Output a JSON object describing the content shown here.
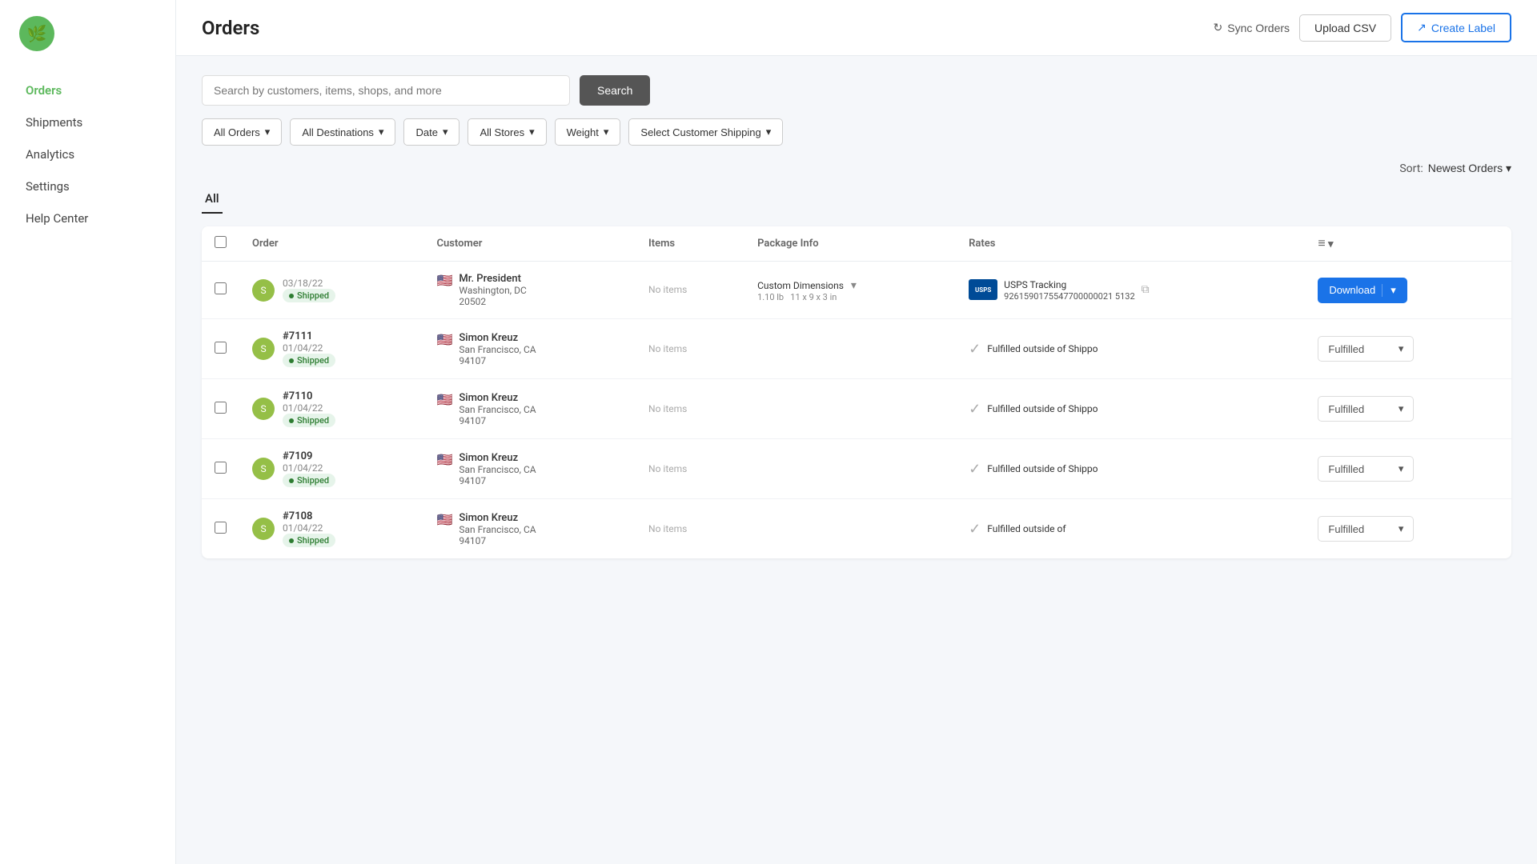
{
  "sidebar": {
    "logo_emoji": "🌿",
    "items": [
      {
        "id": "orders",
        "label": "Orders",
        "active": true
      },
      {
        "id": "shipments",
        "label": "Shipments",
        "active": false
      },
      {
        "id": "analytics",
        "label": "Analytics",
        "active": false
      },
      {
        "id": "settings",
        "label": "Settings",
        "active": false
      },
      {
        "id": "help-center",
        "label": "Help Center",
        "active": false
      }
    ]
  },
  "header": {
    "title": "Orders",
    "sync_label": "Sync Orders",
    "upload_label": "Upload CSV",
    "create_label": "Create Label"
  },
  "search": {
    "placeholder": "Search by customers, items, shops, and more",
    "button_label": "Search"
  },
  "filters": {
    "all_orders": "All Orders",
    "all_destinations": "All Destinations",
    "date": "Date",
    "all_stores": "All Stores",
    "weight": "Weight",
    "select_customer_shipping": "Select Customer Shipping"
  },
  "sort": {
    "label": "Sort:",
    "value": "Newest Orders"
  },
  "tab": {
    "label": "All"
  },
  "table": {
    "headers": [
      "",
      "Order",
      "Customer",
      "Items",
      "Package Info",
      "Rates",
      ""
    ],
    "rows": [
      {
        "id": "row-1",
        "order_num": "",
        "order_date": "03/18/22",
        "store_type": "shopify",
        "status": "Shipped",
        "customer_name": "Mr. President",
        "customer_city": "Washington, DC",
        "customer_zip": "20502",
        "items": "No items",
        "pkg_info": "Custom Dimensions",
        "pkg_weight": "1.10 lb",
        "pkg_dims": "11 x 9 x 3 in",
        "rates_type": "usps",
        "tracking_label": "USPS Tracking",
        "tracking_num": "9261590175547700000021 5132",
        "action": "download"
      },
      {
        "id": "row-2",
        "order_num": "#7111",
        "order_date": "01/04/22",
        "store_type": "shopify",
        "status": "Shipped",
        "customer_name": "Simon Kreuz",
        "customer_city": "San Francisco, CA",
        "customer_zip": "94107",
        "items": "No items",
        "pkg_info": "",
        "pkg_weight": "",
        "pkg_dims": "",
        "rates_type": "fulfilled",
        "tracking_label": "Fulfilled outside of Shippo",
        "tracking_num": "",
        "action": "fulfilled"
      },
      {
        "id": "row-3",
        "order_num": "#7110",
        "order_date": "01/04/22",
        "store_type": "shopify",
        "status": "Shipped",
        "customer_name": "Simon Kreuz",
        "customer_city": "San Francisco, CA",
        "customer_zip": "94107",
        "items": "No items",
        "pkg_info": "",
        "pkg_weight": "",
        "pkg_dims": "",
        "rates_type": "fulfilled",
        "tracking_label": "Fulfilled outside of Shippo",
        "tracking_num": "",
        "action": "fulfilled"
      },
      {
        "id": "row-4",
        "order_num": "#7109",
        "order_date": "01/04/22",
        "store_type": "shopify",
        "status": "Shipped",
        "customer_name": "Simon Kreuz",
        "customer_city": "San Francisco, CA",
        "customer_zip": "94107",
        "items": "No items",
        "pkg_info": "",
        "pkg_weight": "",
        "pkg_dims": "",
        "rates_type": "fulfilled",
        "tracking_label": "Fulfilled outside of Shippo",
        "tracking_num": "",
        "action": "fulfilled"
      },
      {
        "id": "row-5",
        "order_num": "#7108",
        "order_date": "01/04/22",
        "store_type": "shopify",
        "status": "Shipped",
        "customer_name": "Simon Kreuz",
        "customer_city": "San Francisco, CA",
        "customer_zip": "94107",
        "items": "No items",
        "pkg_info": "",
        "pkg_weight": "",
        "pkg_dims": "",
        "rates_type": "fulfilled",
        "tracking_label": "Fulfilled outside of",
        "tracking_num": "",
        "action": "fulfilled"
      }
    ]
  },
  "icons": {
    "sync": "↻",
    "external_link": "↗",
    "chevron_down": "▾",
    "copy": "⧉",
    "checkmark": "✓",
    "columns": "≡"
  }
}
